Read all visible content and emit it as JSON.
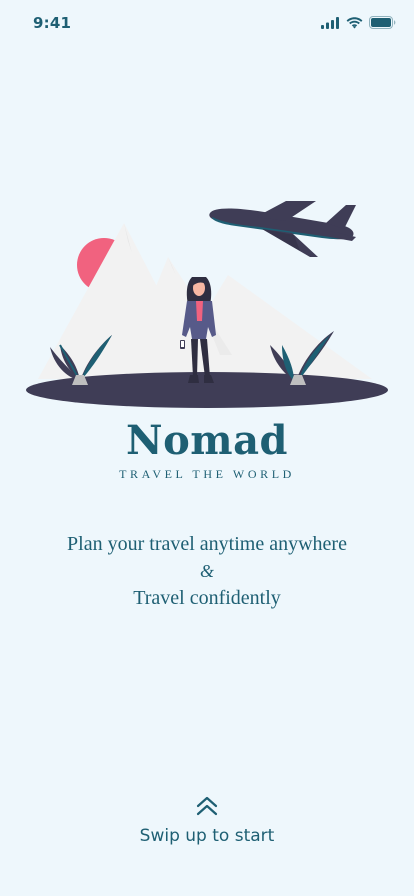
{
  "status_bar": {
    "time": "9:41",
    "icons": [
      "cellular-signal-icon",
      "wifi-icon",
      "battery-icon"
    ]
  },
  "brand": {
    "name": "Nomad",
    "tagline": "TRAVEL THE WORLD"
  },
  "headline": {
    "line1": "Plan your travel anytime anywhere",
    "ampersand": "&",
    "line2": "Travel confidently"
  },
  "cta": {
    "icon": "double-chevron-up-icon",
    "label": "Swip up to start"
  },
  "colors": {
    "background": "#EEF7FC",
    "primary": "#1E5F73",
    "ground": "#3F3D56",
    "sun": "#F1627F",
    "mountain": "#F2F2F2"
  }
}
